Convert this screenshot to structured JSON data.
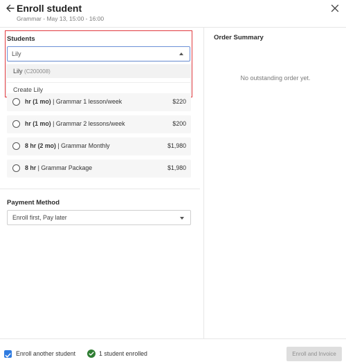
{
  "header": {
    "title": "Enroll student",
    "subtitle": "Grammar - May 13, 15:00 - 16:00"
  },
  "students": {
    "label": "Students",
    "input_value": "Lily",
    "options": [
      {
        "name": "Lily",
        "code": "(C200008)"
      },
      {
        "name": "Create Lily"
      }
    ]
  },
  "courses": [
    {
      "duration": "hr (1 mo)",
      "sep": " | ",
      "name": "Grammar 1 lesson/week",
      "price": "$220"
    },
    {
      "duration": "hr (1 mo)",
      "sep": " | ",
      "name": "Grammar 2 lessons/week",
      "price": "$200"
    },
    {
      "duration": "8 hr (2 mo)",
      "sep": " | ",
      "name": "Grammar Monthly",
      "price": "$1,980"
    },
    {
      "duration": "8 hr",
      "sep": " | ",
      "name": "Grammar Package",
      "price": "$1,980"
    }
  ],
  "payment": {
    "label": "Payment Method",
    "value": "Enroll first, Pay later"
  },
  "order_summary": {
    "title": "Order Summary",
    "empty_text": "No outstanding order yet."
  },
  "footer": {
    "enroll_another_label": "Enroll another student",
    "enroll_another_checked": true,
    "enrolled_status": "1 student enrolled",
    "enroll_button_label": "Enroll and Invoice"
  },
  "colors": {
    "highlight_border": "#e0393e",
    "input_focus": "#6a8fd6",
    "checkbox": "#2f7be0",
    "success": "#2e7d32"
  }
}
